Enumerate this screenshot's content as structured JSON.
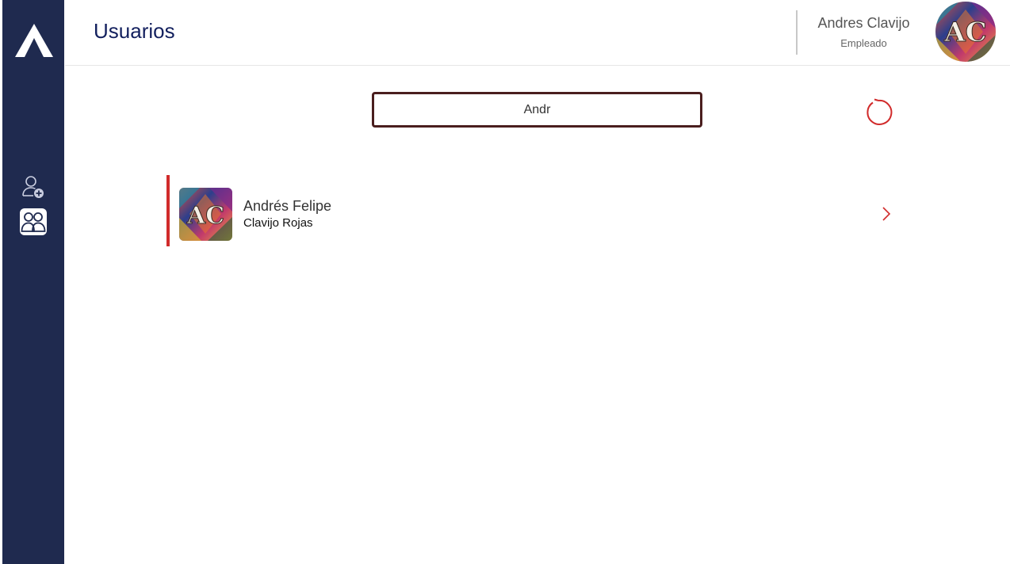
{
  "header": {
    "title": "Usuarios",
    "user_name": "Andres Clavijo",
    "user_role": "Empleado",
    "avatar_initials": "AC"
  },
  "sidebar": {
    "items": [
      {
        "icon": "add-user-icon",
        "active": false
      },
      {
        "icon": "users-icon",
        "active": true
      }
    ]
  },
  "search": {
    "value": "Andr",
    "placeholder": ""
  },
  "users": [
    {
      "first_name": "Andrés Felipe",
      "last_name": "Clavijo Rojas",
      "avatar_initials": "AC"
    }
  ],
  "colors": {
    "sidebar": "#1f2a4f",
    "title": "#13205e",
    "accent_red": "#d12b2b",
    "search_border": "#4a1e1e"
  }
}
